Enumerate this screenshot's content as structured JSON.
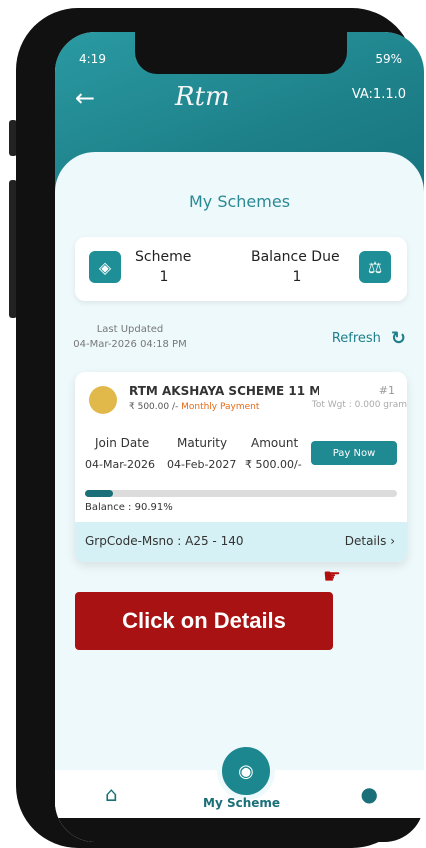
{
  "status_bar": {
    "time": "4:19",
    "battery": "59%"
  },
  "header": {
    "logo_text": "Rtm",
    "version": "VA:1.1.0"
  },
  "page_title": "My Schemes",
  "summary": {
    "scheme_label": "Scheme",
    "scheme_value": "1",
    "balance_label": "Balance Due",
    "balance_value": "1"
  },
  "last_updated": {
    "label": "Last Updated",
    "value": "04-Mar-2026 04:18 PM"
  },
  "refresh_label": "Refresh",
  "scheme_card": {
    "name": "RTM AKSHAYA SCHEME 11 M...",
    "amount_text": "₹ 500.00 /- ",
    "payment_type": "Monthly Payment",
    "index": "#1",
    "total_weight": "Tot Wgt : 0.000 gram",
    "join_label": "Join Date",
    "join_value": "04-Mar-2026",
    "maturity_label": "Maturity",
    "maturity_value": "04-Feb-2027",
    "amount_label": "Amount",
    "amount_value": "₹ 500.00/-",
    "pay_now_label": "Pay Now",
    "progress_fraction": 0.09,
    "balance_text": "Balance : 90.91%",
    "grpcode_text": "GrpCode-Msno : A25 - 140",
    "details_label": "Details"
  },
  "callout": {
    "text": "Click on Details"
  },
  "bottom_nav": {
    "center_label": "My Scheme"
  },
  "colors": {
    "primary": "#1d8790",
    "accent": "#a91212"
  }
}
